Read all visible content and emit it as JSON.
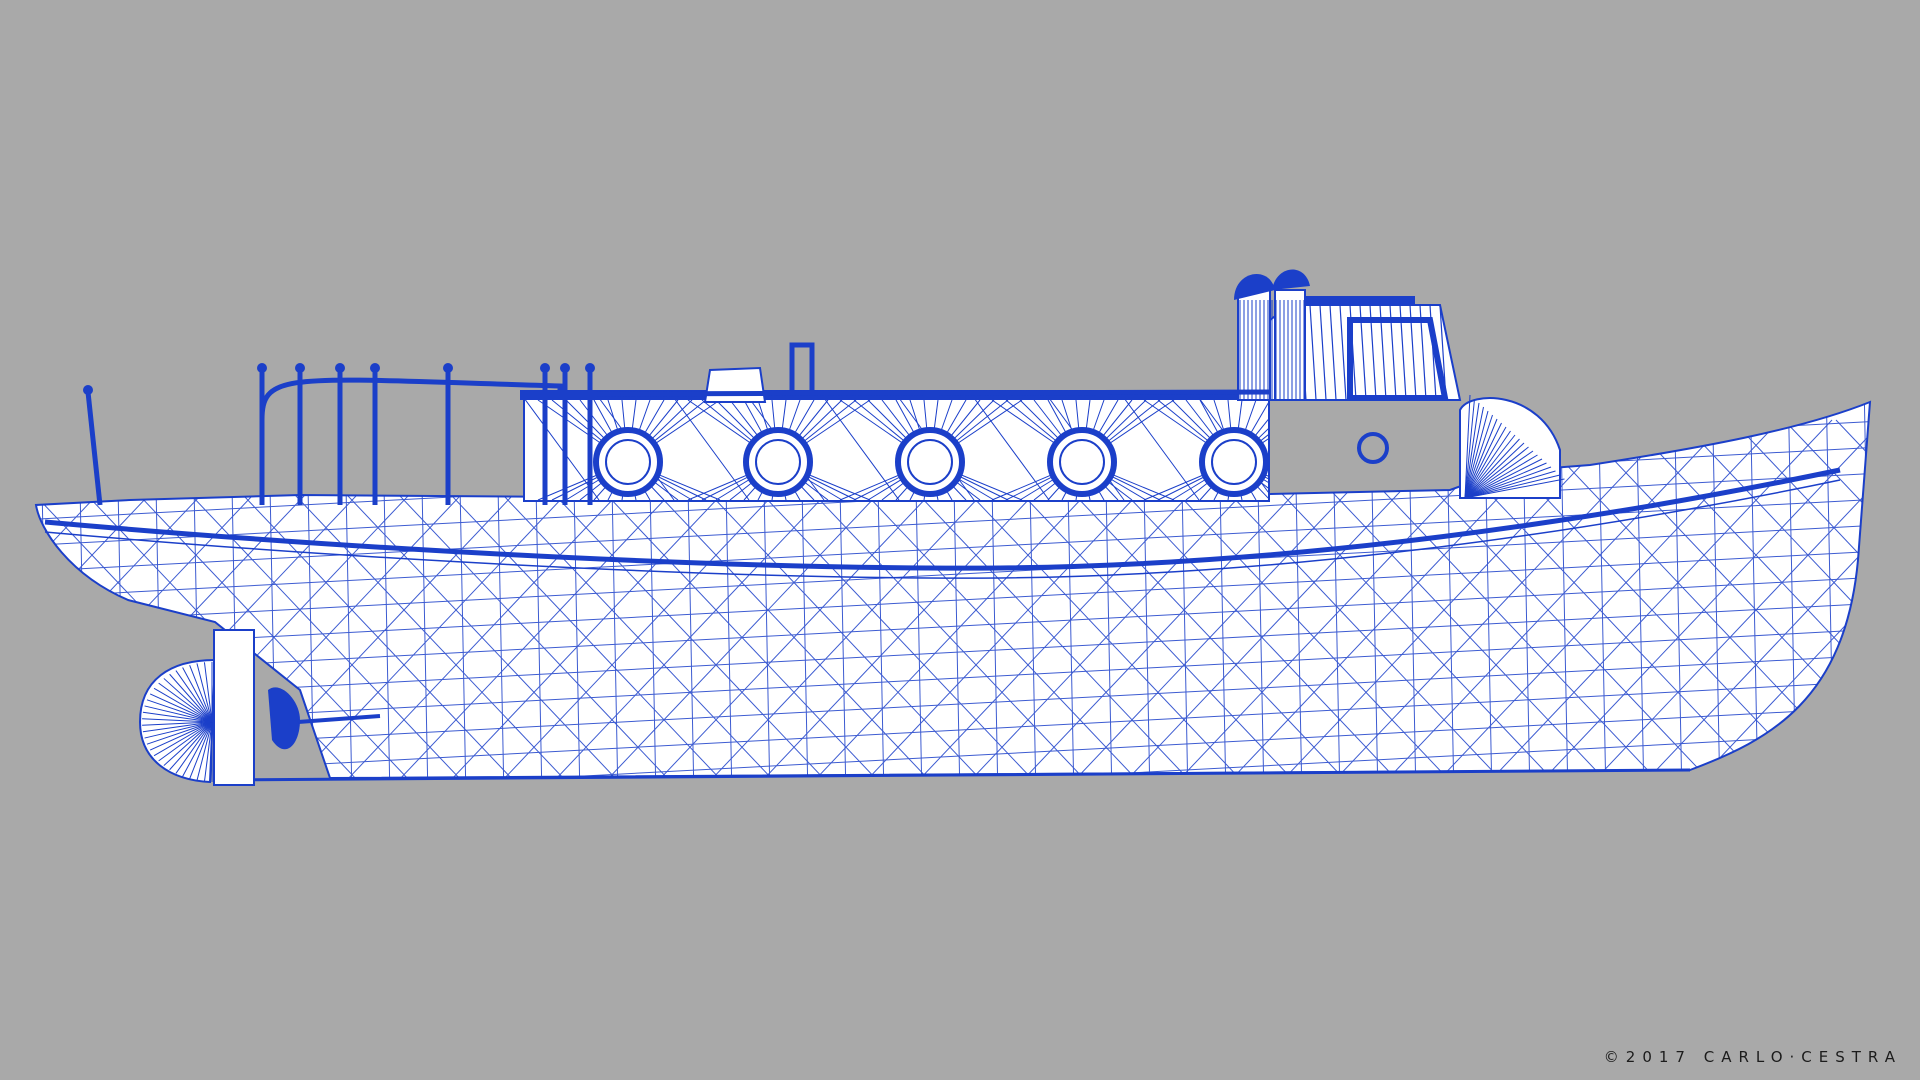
{
  "scene": {
    "subject": "boat-wireframe",
    "view": "side-profile"
  },
  "colors": {
    "background": "#a9a9a9",
    "wire": "#1b3fc9",
    "hull_fill": "#ffffff",
    "credit_text": "#1c1c1c"
  },
  "credit": {
    "text": "©2017 CARLO·CESTRA"
  }
}
